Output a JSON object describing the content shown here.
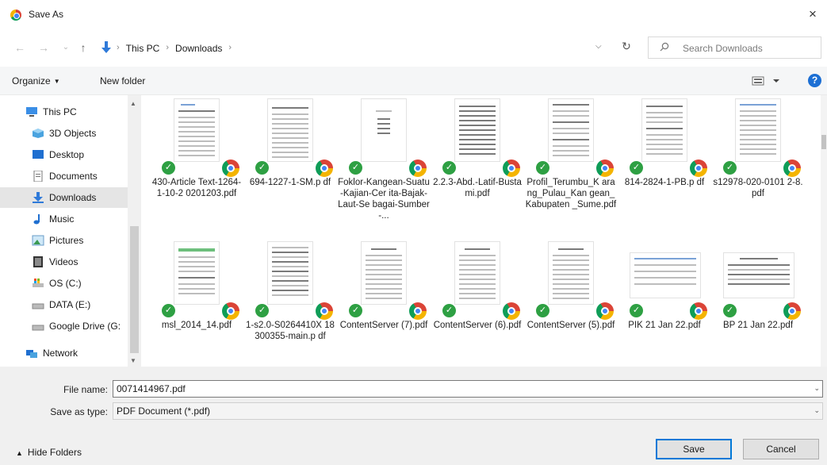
{
  "window": {
    "title": "Save As",
    "close_glyph": "×"
  },
  "nav": {
    "back_glyph": "←",
    "forward_glyph": "→",
    "recent_glyph": "⌄",
    "up_glyph": "↑",
    "breadcrumbs": [
      "This PC",
      "Downloads"
    ],
    "separator": "›",
    "refresh_glyph": "↻",
    "search_placeholder": "Search Downloads"
  },
  "toolbar": {
    "organize_label": "Organize",
    "new_folder_label": "New folder",
    "help_label": "?"
  },
  "sidebar": {
    "items": [
      {
        "label": "This PC",
        "icon": "pc-icon"
      },
      {
        "label": "3D Objects",
        "icon": "3d-objects-icon"
      },
      {
        "label": "Desktop",
        "icon": "desktop-icon"
      },
      {
        "label": "Documents",
        "icon": "documents-icon"
      },
      {
        "label": "Downloads",
        "icon": "downloads-icon",
        "selected": true
      },
      {
        "label": "Music",
        "icon": "music-icon"
      },
      {
        "label": "Pictures",
        "icon": "pictures-icon"
      },
      {
        "label": "Videos",
        "icon": "videos-icon"
      },
      {
        "label": "OS (C:)",
        "icon": "drive-os-icon"
      },
      {
        "label": "DATA (E:)",
        "icon": "drive-icon"
      },
      {
        "label": "Google Drive (G:",
        "icon": "drive-icon"
      },
      {
        "label": "Network",
        "icon": "network-icon"
      }
    ]
  },
  "files": [
    {
      "name": "430-Article Text-1264-1-10-2 0201203.pdf"
    },
    {
      "name": "694-1227-1-SM.p df"
    },
    {
      "name": "Foklor-Kangean-Suatu-Kajian-Cer ita-Bajak-Laut-Se bagai-Sumber-..."
    },
    {
      "name": "2.2.3-Abd.-Latif-Bustami.pdf"
    },
    {
      "name": "Profil_Terumbu_K arang_Pulau_Kan gean_Kabupaten _Sume.pdf"
    },
    {
      "name": "814-2824-1-PB.p df"
    },
    {
      "name": "s12978-020-0101 2-8.pdf"
    },
    {
      "name": "msl_2014_14.pdf"
    },
    {
      "name": "1-s2.0-S0264410X 18300355-main.p df"
    },
    {
      "name": "ContentServer (7).pdf"
    },
    {
      "name": "ContentServer (6).pdf"
    },
    {
      "name": "ContentServer (5).pdf"
    },
    {
      "name": "PIK 21 Jan 22.pdf"
    },
    {
      "name": "BP 21 Jan 22.pdf"
    }
  ],
  "form": {
    "file_name_label": "File name:",
    "file_name_value": "0071414967.pdf",
    "save_type_label": "Save as type:",
    "save_type_value": "PDF Document (*.pdf)",
    "hide_folders_label": "Hide Folders",
    "save_label": "Save",
    "cancel_label": "Cancel"
  },
  "colors": {
    "accent": "#0078d7",
    "sync_check": "#2ea043",
    "help": "#1c6fd4",
    "selected_bg": "#e5e5e5"
  }
}
